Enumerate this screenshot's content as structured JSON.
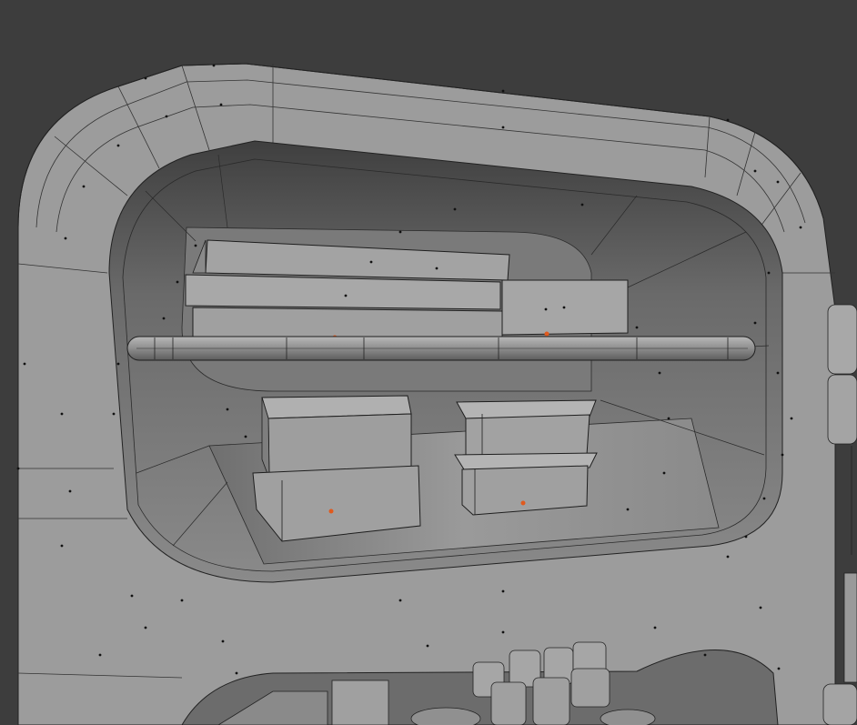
{
  "viewport": {
    "background_color": "#3d3d3d",
    "mesh_color": "#9a9a9a",
    "wire_color": "#1e1e1e",
    "vertex_color": "#111111",
    "origin_color": "#e05a1e"
  },
  "scene": {
    "objects": [
      {
        "name": "crate-top-1",
        "kind": "box"
      },
      {
        "name": "crate-top-2",
        "kind": "box"
      },
      {
        "name": "crate-top-3",
        "kind": "box"
      },
      {
        "name": "crate-right",
        "kind": "box"
      },
      {
        "name": "shelf-rail",
        "kind": "cylinder"
      },
      {
        "name": "crate-lower-left-top",
        "kind": "box"
      },
      {
        "name": "crate-lower-left-bottom",
        "kind": "box"
      },
      {
        "name": "container-right-top",
        "kind": "box"
      },
      {
        "name": "container-right-bottom",
        "kind": "box"
      }
    ]
  }
}
